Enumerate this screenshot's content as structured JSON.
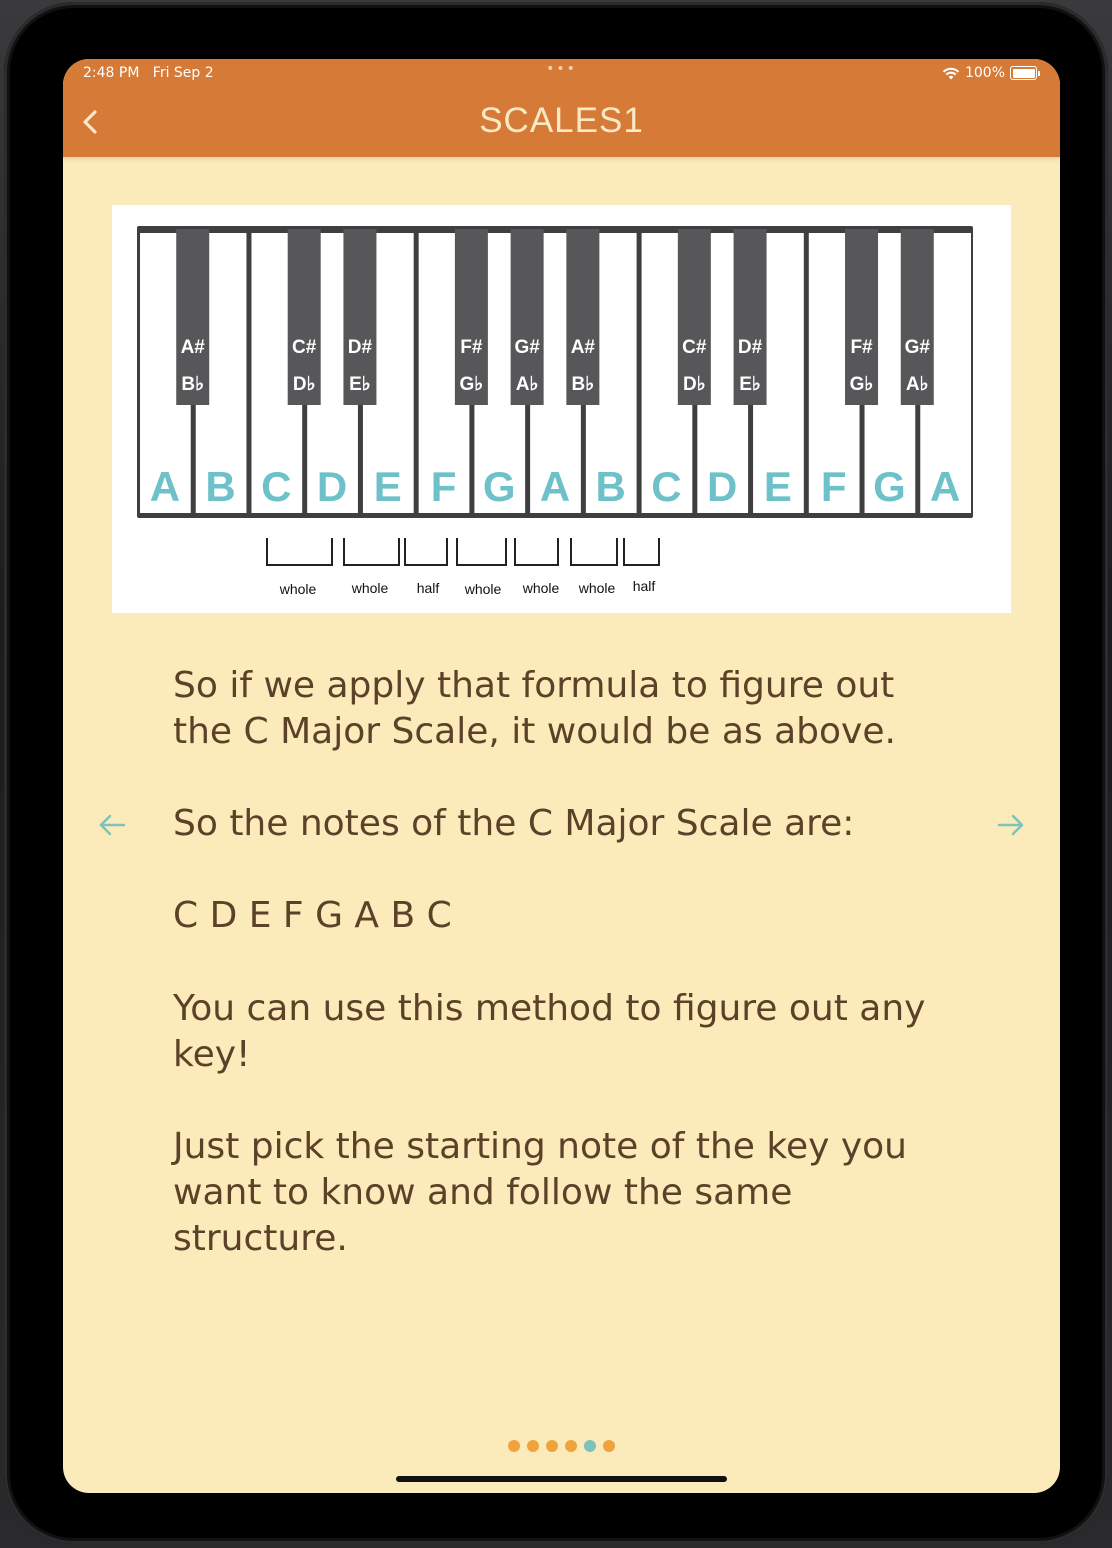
{
  "status_bar": {
    "time": "2:48 PM",
    "date": "Fri Sep 2",
    "dots": "•••",
    "battery": "100%"
  },
  "navbar": {
    "title": "SCALES1"
  },
  "piano": {
    "white_keys": [
      "A",
      "B",
      "C",
      "D",
      "E",
      "F",
      "G",
      "A",
      "B",
      "C",
      "D",
      "E",
      "F",
      "G",
      "A"
    ],
    "black_keys": [
      {
        "sharp": "A#",
        "flat": "B♭"
      },
      {
        "sharp": "C#",
        "flat": "D♭"
      },
      {
        "sharp": "D#",
        "flat": "E♭"
      },
      {
        "sharp": "F#",
        "flat": "G♭"
      },
      {
        "sharp": "G#",
        "flat": "A♭"
      },
      {
        "sharp": "A#",
        "flat": "B♭"
      },
      {
        "sharp": "C#",
        "flat": "D♭"
      },
      {
        "sharp": "D#",
        "flat": "E♭"
      },
      {
        "sharp": "F#",
        "flat": "G♭"
      },
      {
        "sharp": "G#",
        "flat": "A♭"
      }
    ],
    "steps": [
      "whole",
      "whole",
      "half",
      "whole",
      "whole",
      "whole",
      "half"
    ]
  },
  "content": {
    "p1": "So if we apply that formula to figure out the C Major Scale, it would be as above.",
    "p2": "So the notes of the C Major Scale are:",
    "p3": "C D E F G A B C",
    "p4": "You can use this method to figure out any key!",
    "p5": "Just pick the starting note of the key you want to know and follow the same structure."
  },
  "colors": {
    "navbar": "#D67A38",
    "background": "#FBEBBB",
    "note_letters": "#6EC1C9",
    "arrows": "#7DC3B9",
    "pager_dot": "#F0A33A",
    "pager_active": "#7DC3B9"
  },
  "pager": {
    "count": 6,
    "active_index": 4
  }
}
